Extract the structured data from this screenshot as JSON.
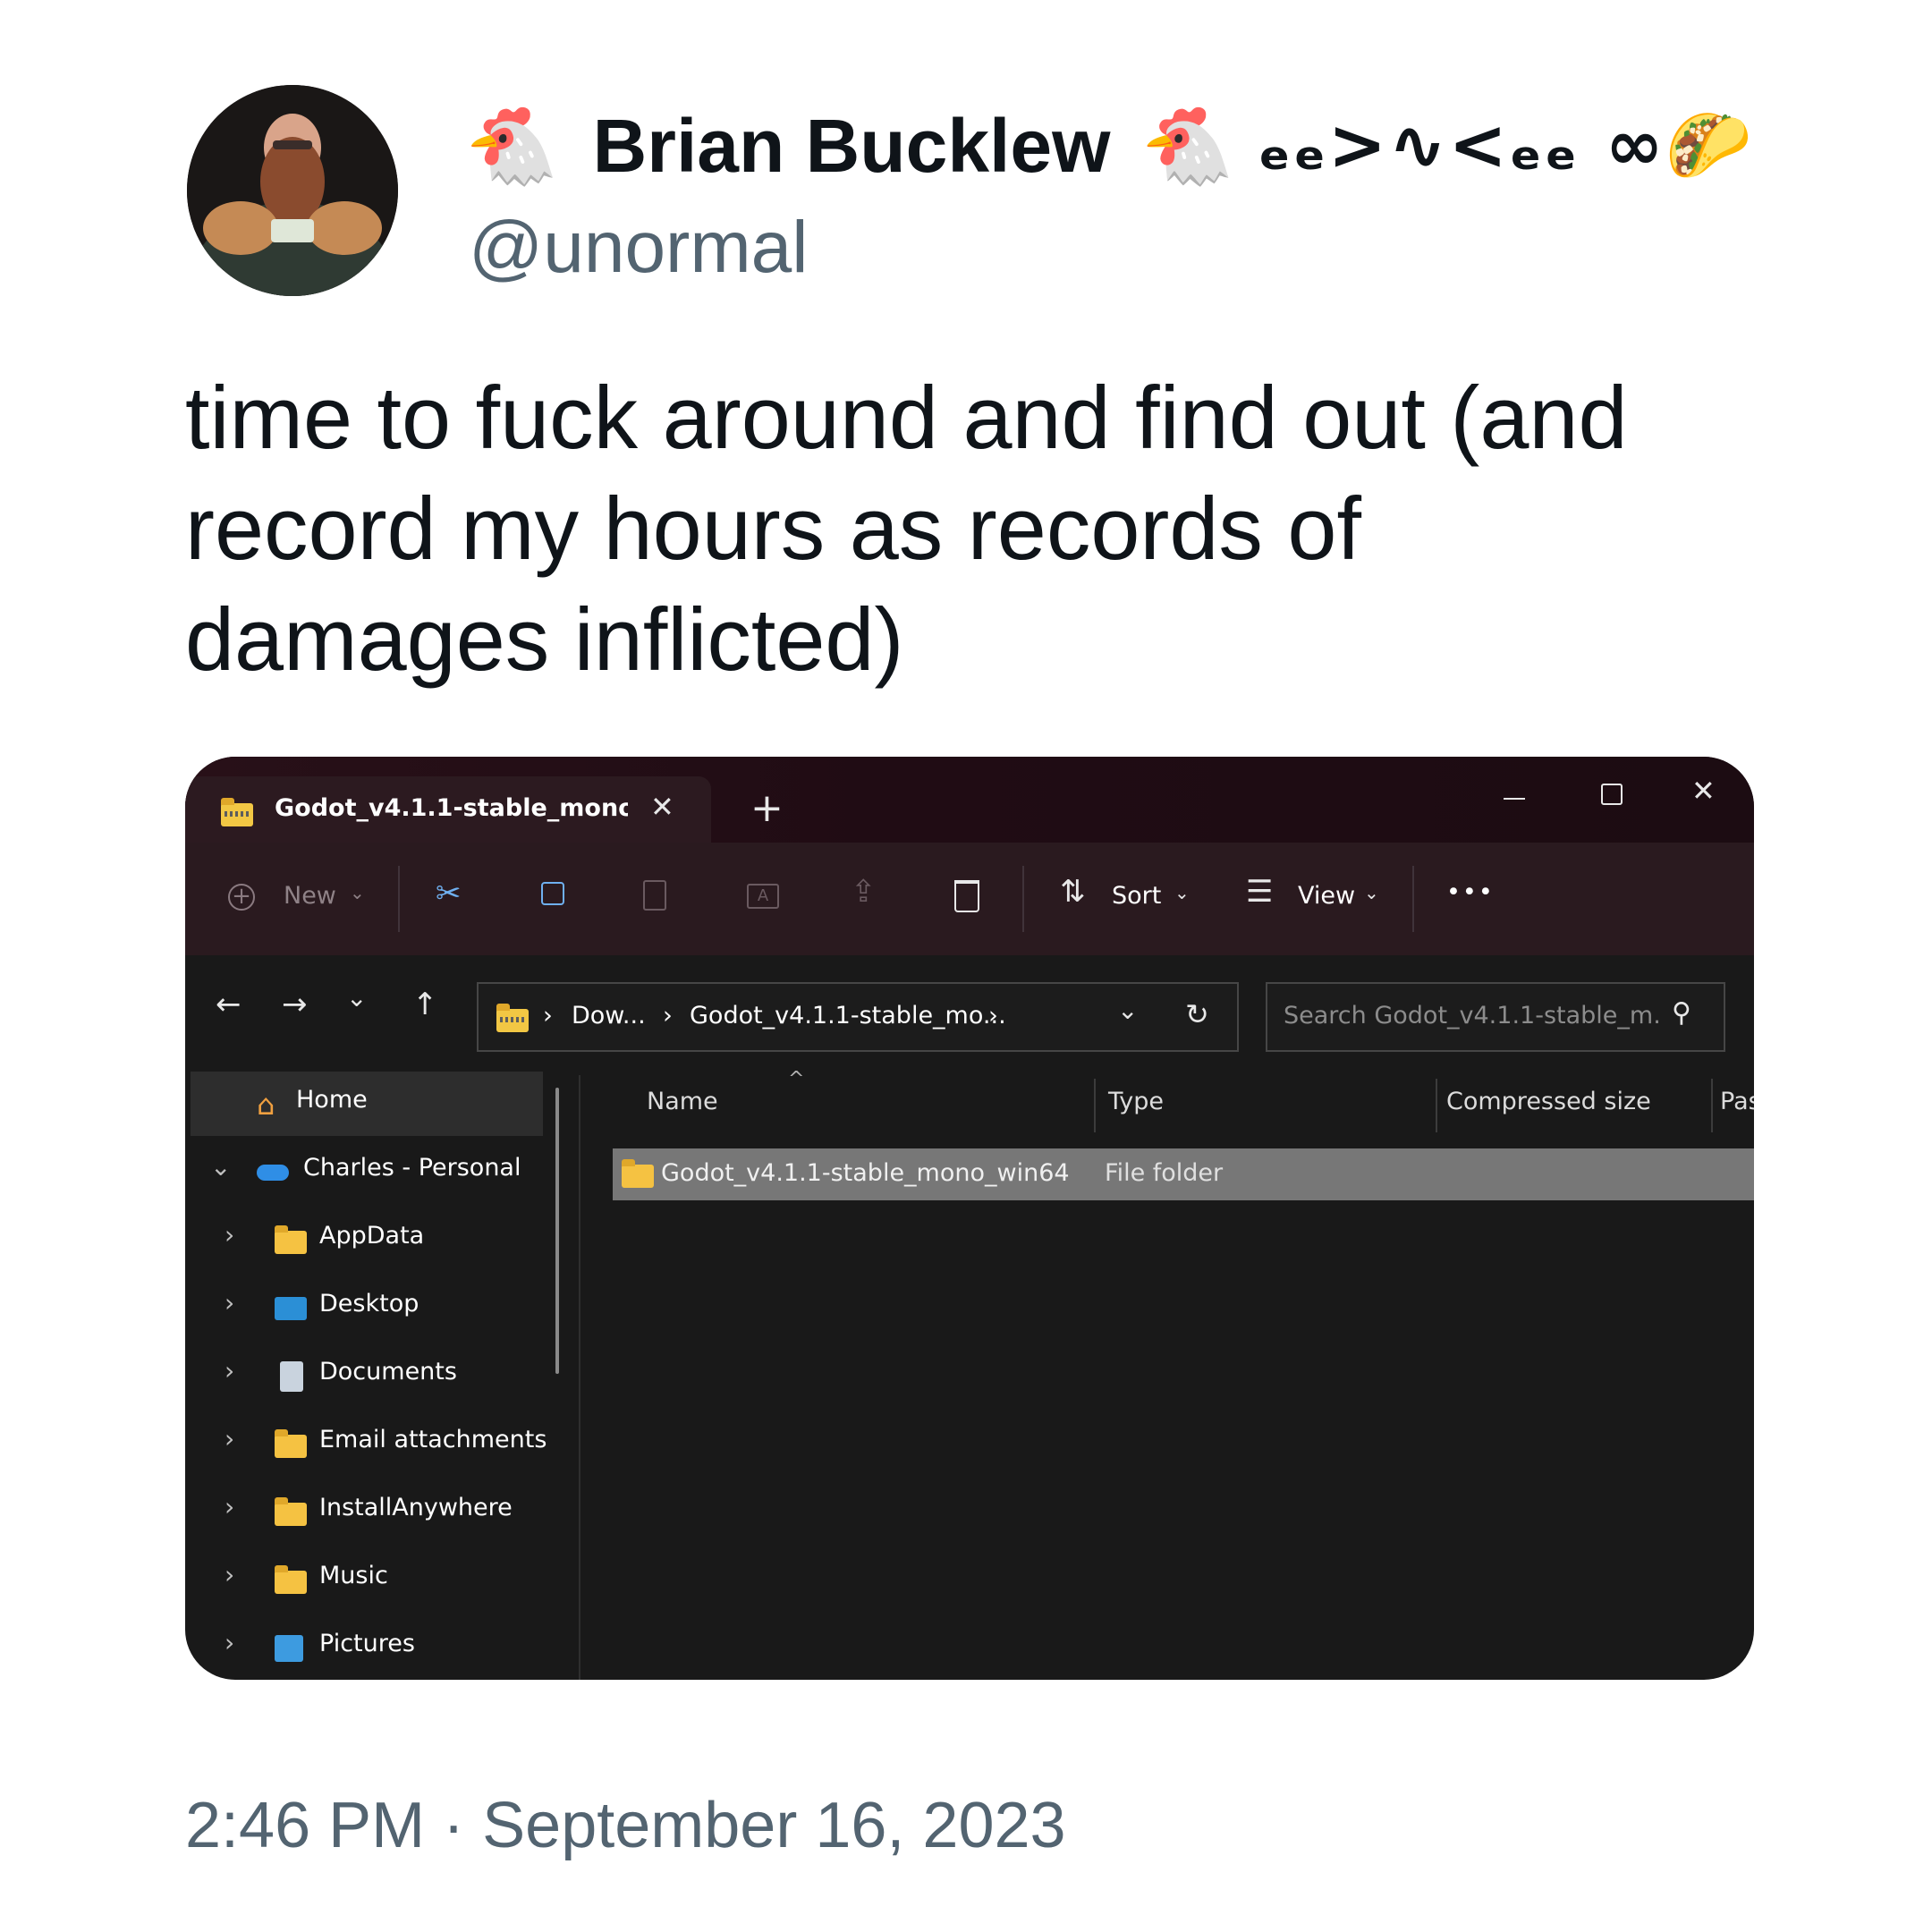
{
  "tweet": {
    "display_name": "Brian Bucklew",
    "name_emoji_left": "🐔",
    "name_emoji_right": "🐔",
    "name_decoration": "ₑₑ>∿<ₑₑ ∞🌮",
    "handle": "@unormal",
    "text": "time to fuck around and find out (and\nrecord my hours as records of\ndamages inflicted)",
    "timestamp": "2:46 PM · September 16, 2023"
  },
  "explorer": {
    "tab_title": "Godot_v4.1.1-stable_mono_win64",
    "toolbar": {
      "new_label": "New",
      "sort_label": "Sort",
      "view_label": "View",
      "more_label": "•••"
    },
    "address": {
      "crumbs": [
        "Dow...",
        "Godot_v4.1.1-stable_mo..."
      ],
      "separator": "›"
    },
    "search_placeholder": "Search Godot_v4.1.1-stable_m...",
    "sidebar": {
      "items": [
        {
          "label": "Home"
        },
        {
          "label": "Charles - Personal"
        },
        {
          "label": "AppData"
        },
        {
          "label": "Desktop"
        },
        {
          "label": "Documents"
        },
        {
          "label": "Email attachments"
        },
        {
          "label": "InstallAnywhere"
        },
        {
          "label": "Music"
        },
        {
          "label": "Pictures"
        }
      ]
    },
    "columns": [
      "Name",
      "Type",
      "Compressed size",
      "Pas"
    ],
    "files": [
      {
        "name": "Godot_v4.1.1-stable_mono_win64",
        "type": "File folder"
      }
    ],
    "colors": {
      "titlebar": "#281018",
      "content_bg": "#191919",
      "selected_row": "#777777",
      "folder": "#f5c242"
    }
  }
}
